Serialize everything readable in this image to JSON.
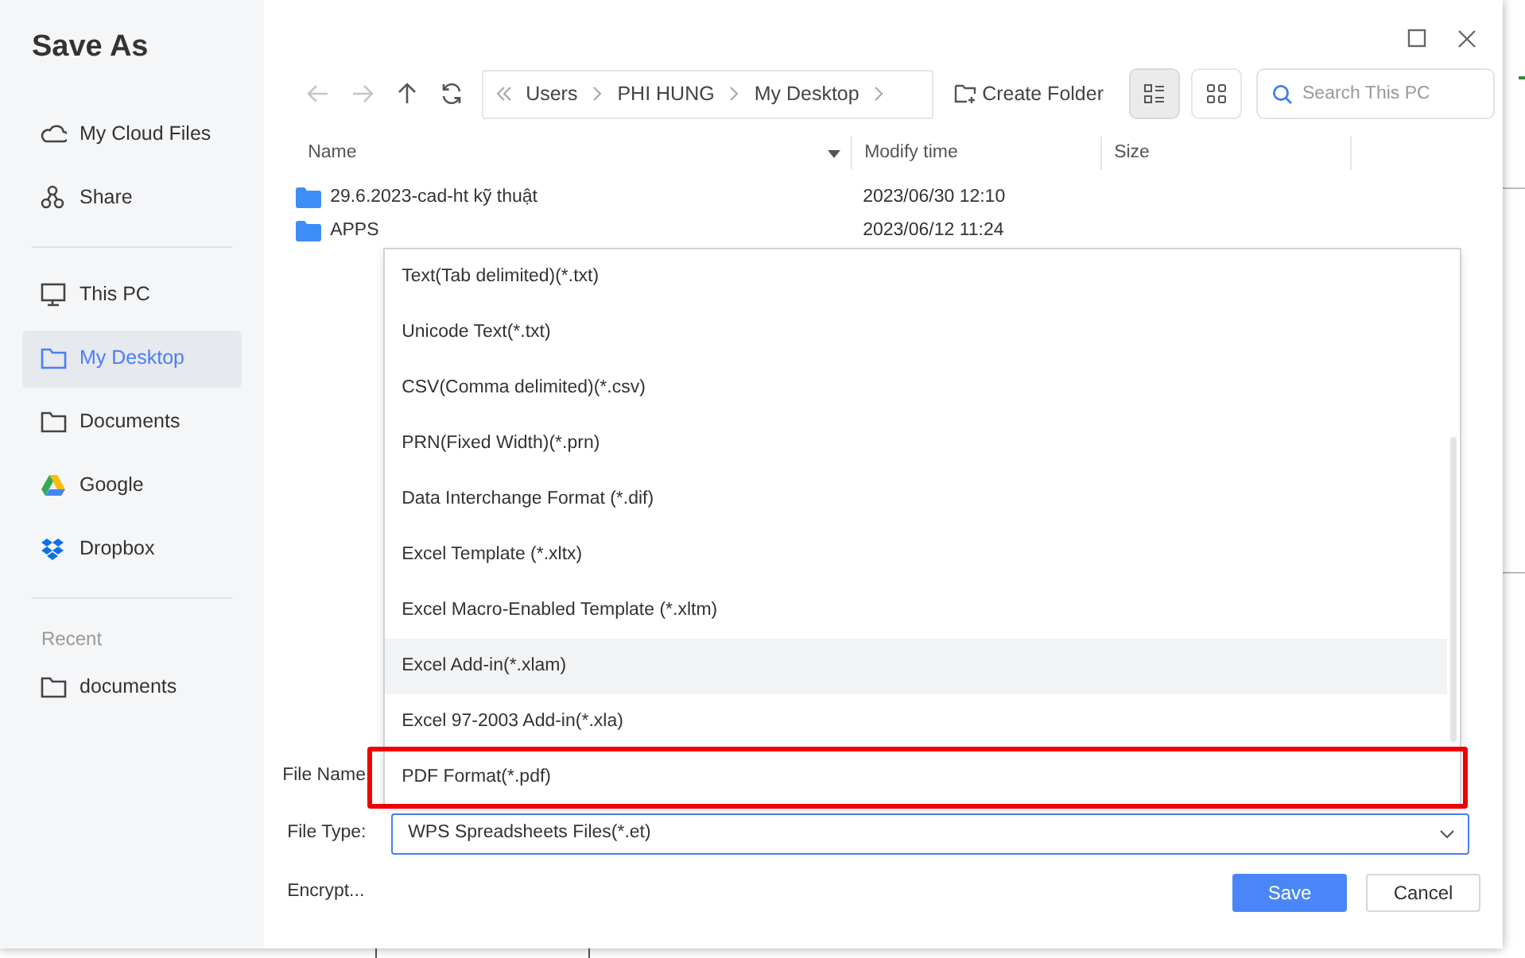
{
  "window": {
    "title": "Save As"
  },
  "sidebar": {
    "sections": [
      {
        "items": [
          {
            "label": "My Cloud Files",
            "kind": "cloud",
            "selected": false
          },
          {
            "label": "Share",
            "kind": "share",
            "selected": false
          }
        ]
      },
      {
        "items": [
          {
            "label": "This PC",
            "kind": "pc",
            "selected": false
          },
          {
            "label": "My Desktop",
            "kind": "folder",
            "selected": true
          },
          {
            "label": "Documents",
            "kind": "folder",
            "selected": false
          },
          {
            "label": "Google",
            "kind": "google",
            "selected": false
          },
          {
            "label": "Dropbox",
            "kind": "dropbox",
            "selected": false
          }
        ]
      },
      {
        "heading": "Recent",
        "items": [
          {
            "label": "documents",
            "kind": "folder",
            "selected": false
          }
        ]
      }
    ]
  },
  "toolbar": {
    "nav_buttons": [
      {
        "kind": "back",
        "disabled": true
      },
      {
        "kind": "forward",
        "disabled": true
      },
      {
        "kind": "up",
        "disabled": false
      },
      {
        "kind": "refresh",
        "disabled": false
      }
    ],
    "breadcrumb": [
      "Users",
      "PHI HUNG",
      "My Desktop"
    ],
    "create_folder": "Create Folder",
    "view_buttons": [
      {
        "kind": "list",
        "selected": true
      },
      {
        "kind": "grid",
        "selected": false
      }
    ],
    "search": {
      "placeholder": "Search This PC"
    }
  },
  "file_list": {
    "columns": [
      {
        "label": "Name",
        "sorted": true
      },
      {
        "label": "Modify time",
        "sorted": false
      },
      {
        "label": "Size",
        "sorted": false
      }
    ],
    "rows": [
      {
        "name": "29.6.2023-cad-ht kỹ thuật",
        "modify_time": "2023/06/30 12:10"
      },
      {
        "name": "APPS",
        "modify_time": "2023/06/12 11:24"
      }
    ]
  },
  "file_name": {
    "label": "File Name"
  },
  "file_type": {
    "label": "File Type:",
    "value": "WPS Spreadsheets Files(*.et)",
    "expanded": true,
    "options": [
      {
        "label": "Text(Tab delimited)(*.txt)",
        "hovered": false,
        "annotated": false
      },
      {
        "label": "Unicode Text(*.txt)",
        "hovered": false,
        "annotated": false
      },
      {
        "label": "CSV(Comma delimited)(*.csv)",
        "hovered": false,
        "annotated": false
      },
      {
        "label": "PRN(Fixed Width)(*.prn)",
        "hovered": false,
        "annotated": false
      },
      {
        "label": "Data Interchange Format (*.dif)",
        "hovered": false,
        "annotated": false
      },
      {
        "label": "Excel Template (*.xltx)",
        "hovered": false,
        "annotated": false
      },
      {
        "label": "Excel Macro-Enabled Template (*.xltm)",
        "hovered": false,
        "annotated": false
      },
      {
        "label": "Excel Add-in(*.xlam)",
        "hovered": true,
        "annotated": false
      },
      {
        "label": "Excel 97-2003 Add-in(*.xla)",
        "hovered": false,
        "annotated": false
      },
      {
        "label": "PDF Format(*.pdf)",
        "hovered": false,
        "annotated": true
      }
    ]
  },
  "encrypt": "Encrypt...",
  "buttons": [
    {
      "label": "Save",
      "kind": "primary"
    },
    {
      "label": "Cancel",
      "kind": "secondary"
    }
  ]
}
